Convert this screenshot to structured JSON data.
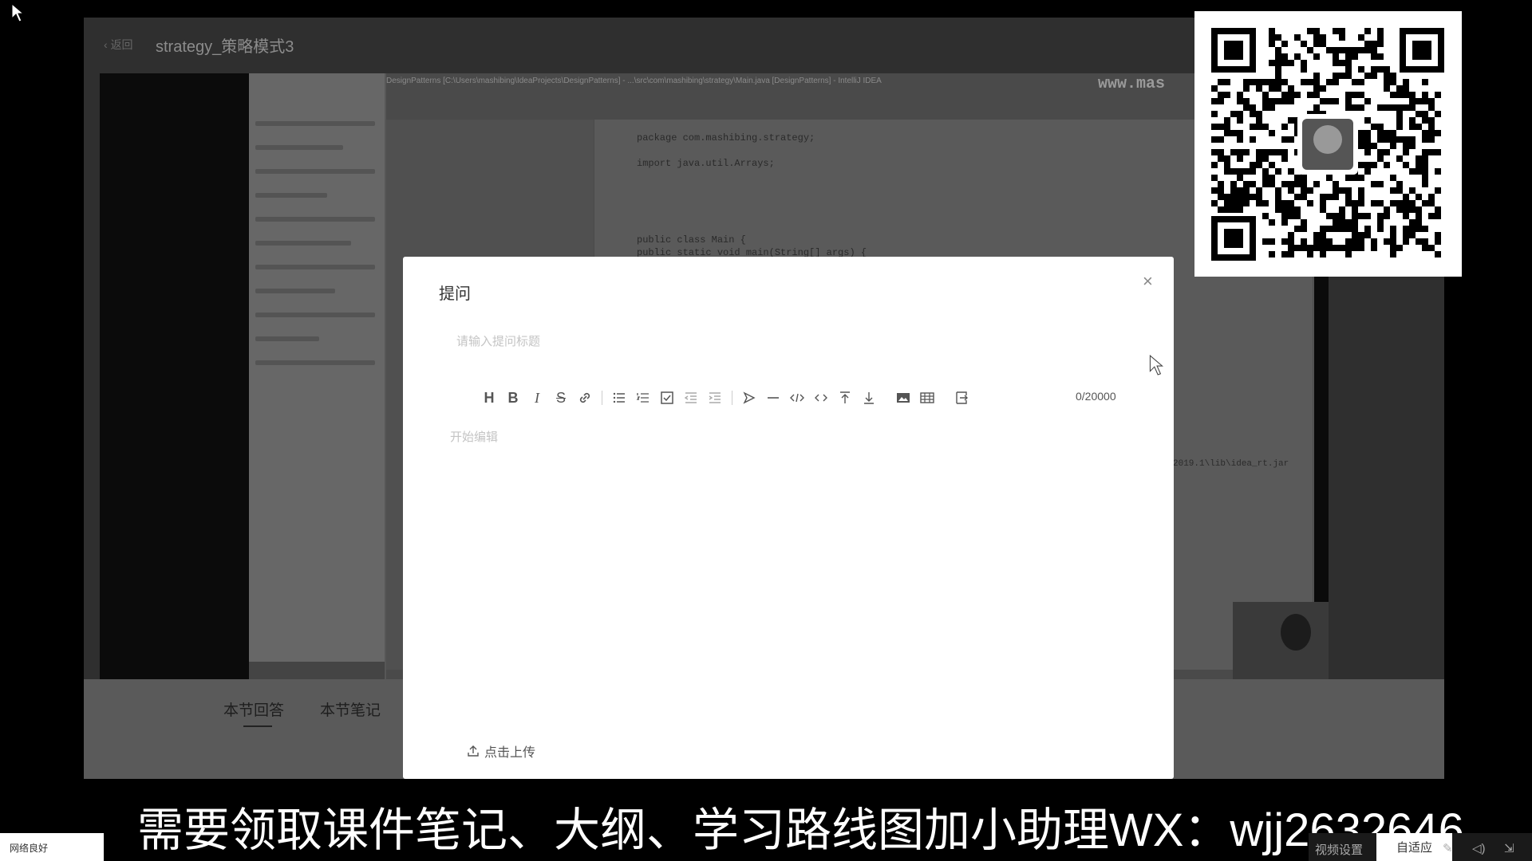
{
  "page": {
    "back_label": "返回",
    "title": "strategy_策略模式3"
  },
  "ide": {
    "window_title": "DesignPatterns [C:\\Users\\mashibing\\IdeaProjects\\DesignPatterns] - ...\\src\\com\\mashibing\\strategy\\Main.java [DesignPatterns] - IntelliJ IDEA",
    "watermark": "www.mas",
    "code_lines": [
      "package com.mashibing.strategy;",
      "import java.util.Arrays;",
      "public class Main {",
      "    public static void main(String[] args) {"
    ],
    "console_text": "2019.1\\lib\\idea_rt.jar"
  },
  "tabs": [
    {
      "label": "本节回答"
    },
    {
      "label": "本节笔记"
    }
  ],
  "modal": {
    "title": "提问",
    "title_placeholder": "请输入提问标题",
    "body_placeholder": "开始编辑",
    "char_count": "0/20000",
    "upload_label": "点击上传",
    "toolbar_icons": [
      "heading-icon",
      "bold-icon",
      "italic-icon",
      "strikethrough-icon",
      "link-icon",
      "bullet-list-icon",
      "ordered-list-icon",
      "checklist-icon",
      "outdent-icon",
      "indent-icon",
      "quote-icon",
      "horizontal-rule-icon",
      "code-block-icon",
      "inline-code-icon",
      "insert-before-icon",
      "insert-after-icon",
      "image-icon",
      "table-icon",
      "fullscreen-icon"
    ]
  },
  "caption": "需要领取课件笔记、大纲、学习路线图加小助理WX：wjj2632646",
  "player": {
    "left_label": "网络良好",
    "video_settings": "视频设置",
    "fit_label": "自适应"
  },
  "colors": {
    "modal_bg": "#ffffff",
    "overlay": "#2f2f2f",
    "caption_text": "#ffffff"
  }
}
